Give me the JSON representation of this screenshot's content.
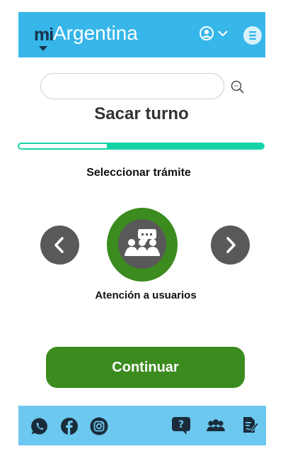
{
  "header": {
    "logo_prefix": "mi",
    "logo_name": "Argentina",
    "user_menu_icon": "user-circle-icon",
    "menu_icon": "hamburger-icon"
  },
  "search": {
    "value": "",
    "placeholder": "",
    "icon": "search-icon"
  },
  "page": {
    "title": "Sacar turno",
    "progress_percent": 64,
    "step_label": "Seleccionar trámite"
  },
  "carousel": {
    "prev_icon": "chevron-left-icon",
    "next_icon": "chevron-right-icon",
    "selected_option": {
      "label": "Atención a usuarios",
      "icon": "people-chat-icon"
    }
  },
  "actions": {
    "continue_label": "Continuar"
  },
  "footer": {
    "social": [
      "whatsapp-icon",
      "facebook-icon",
      "instagram-icon"
    ],
    "tools": [
      "help-chat-icon",
      "community-icon",
      "document-edit-icon"
    ]
  },
  "colors": {
    "header_bg": "#37b6ea",
    "footer_bg": "#6cc8ef",
    "primary_green": "#3b8b1f",
    "progress": "#13d3a6",
    "nav_gray": "#595959"
  }
}
